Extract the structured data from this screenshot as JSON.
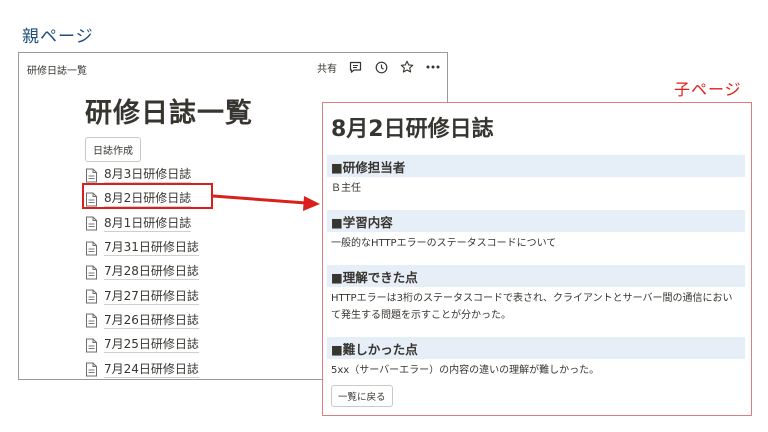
{
  "captions": {
    "parent": "親ページ",
    "child": "子ページ"
  },
  "parent": {
    "breadcrumb": "研修日誌一覧",
    "share_label": "共有",
    "icons": [
      "comment-icon",
      "clock-icon",
      "star-icon",
      "more-icon"
    ],
    "title": "研修日誌一覧",
    "create_button": "日誌作成",
    "items": [
      "8月3日研修日誌",
      "8月2日研修日誌",
      "8月1日研修日誌",
      "7月31日研修日誌",
      "7月28日研修日誌",
      "7月27日研修日誌",
      "7月26日研修日誌",
      "7月25日研修日誌",
      "7月24日研修日誌"
    ],
    "highlighted_item": "8月2日研修日誌"
  },
  "child": {
    "title": "8月2日研修日誌",
    "sections": [
      {
        "heading": "■研修担当者",
        "body": "Ｂ主任"
      },
      {
        "heading": "■学習内容",
        "body": "一般的なHTTPエラーのステータスコードについて"
      },
      {
        "heading": "■理解できた点",
        "body": "HTTPエラーは3桁のステータスコードで表され、クライアントとサーバー間の通信において発生する問題を示すことが分かった。"
      },
      {
        "heading": "■難しかった点",
        "body": "5xx（サーバーエラー）の内容の違いの理解が難しかった。"
      }
    ],
    "back_button": "一覧に戻る"
  },
  "colors": {
    "highlight": "#d9201b",
    "parent_caption": "#1f4e79",
    "child_caption": "#e0201a",
    "section_bg": "#e6eef7"
  }
}
